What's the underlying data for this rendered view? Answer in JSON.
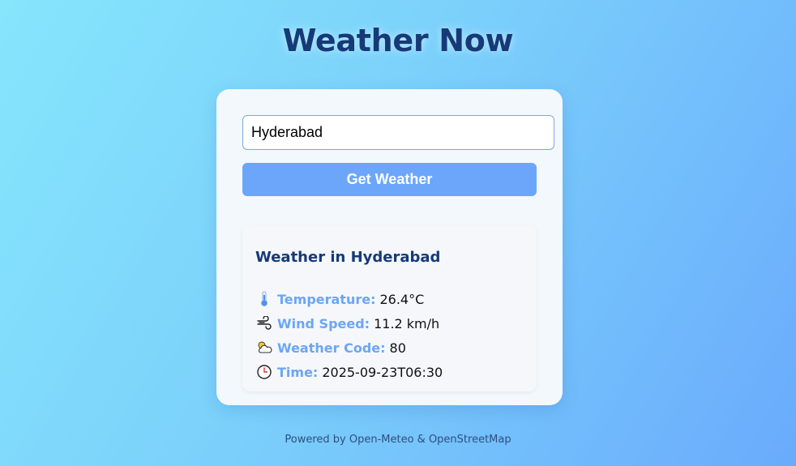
{
  "header": {
    "title": "Weather Now"
  },
  "search": {
    "value": "Hyderabad"
  },
  "actions": {
    "get_weather_label": "Get Weather"
  },
  "result": {
    "heading": "Weather in Hyderabad",
    "rows": [
      {
        "icon": "thermometer-icon",
        "label": "Temperature:",
        "value": "26.4°C"
      },
      {
        "icon": "wind-icon",
        "label": "Wind Speed:",
        "value": "11.2 km/h"
      },
      {
        "icon": "sun-behind-cloud-icon",
        "label": "Weather Code:",
        "value": "80"
      },
      {
        "icon": "clock-icon",
        "label": "Time:",
        "value": "2025-09-23T06:30"
      }
    ]
  },
  "footer": {
    "text": "Powered by Open-Meteo & OpenStreetMap"
  },
  "colors": {
    "title": "#163a78",
    "accent": "#6ba6fb",
    "label": "#6ba6f5",
    "card": "#f3f8fd"
  }
}
